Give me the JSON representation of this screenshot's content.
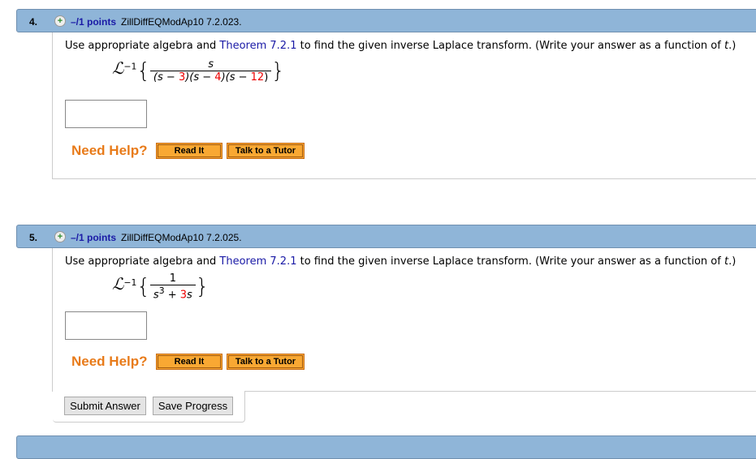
{
  "questions": [
    {
      "number": "4.",
      "points": "–/1 points",
      "source": "ZillDiffEQModAp10 7.2.023.",
      "prompt_before": "Use appropriate algebra and ",
      "theorem_link": "Theorem 7.2.1",
      "prompt_after": " to find the given inverse Laplace transform. (Write your answer as a function of ",
      "var": "t",
      "prompt_end": ".)",
      "laplace": "ℒ",
      "inverse": "−1",
      "numerator": "s",
      "den": [
        "(s − ",
        "3",
        ")(s − ",
        "4",
        ")(s − ",
        "12",
        ")"
      ],
      "answer": "",
      "need_help": "Need Help?",
      "read_it": "Read It",
      "tutor": "Talk to a Tutor"
    },
    {
      "number": "5.",
      "points": "–/1 points",
      "source": "ZillDiffEQModAp10 7.2.025.",
      "prompt_before": "Use appropriate algebra and ",
      "theorem_link": "Theorem 7.2.1",
      "prompt_after": " to find the given inverse Laplace transform. (Write your answer as a function of ",
      "var": "t",
      "prompt_end": ".)",
      "laplace": "ℒ",
      "inverse": "−1",
      "numerator": "1",
      "den": [
        "s",
        "3",
        " + ",
        "3",
        "s"
      ],
      "answer": "",
      "need_help": "Need Help?",
      "read_it": "Read It",
      "tutor": "Talk to a Tutor"
    }
  ],
  "actions": {
    "submit": "Submit Answer",
    "save": "Save Progress"
  },
  "colors": {
    "header": "#8fb5d8",
    "help": "#e87b1a",
    "button": "#f9a833",
    "link": "#1a1aa6"
  }
}
